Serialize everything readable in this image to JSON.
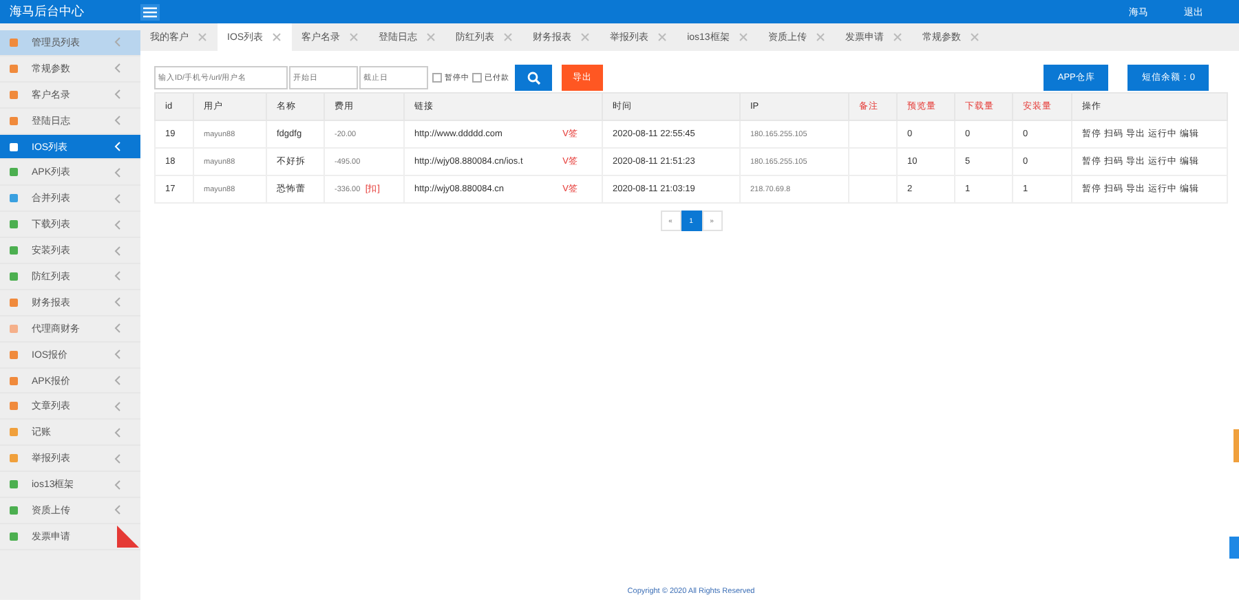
{
  "header": {
    "title": "海马后台中心",
    "user": "海马",
    "logout": "退出"
  },
  "sidebar": {
    "items": [
      {
        "label": "管理员列表",
        "color": "#f08a3c",
        "selected": false,
        "hover": true,
        "ribbon": false
      },
      {
        "label": "常规参数",
        "color": "#f08a3c",
        "selected": false,
        "hover": false,
        "ribbon": false
      },
      {
        "label": "客户名录",
        "color": "#f08a3c",
        "selected": false,
        "hover": false,
        "ribbon": false
      },
      {
        "label": "登陆日志",
        "color": "#f08a3c",
        "selected": false,
        "hover": false,
        "ribbon": false
      },
      {
        "label": "IOS列表",
        "color": "#ffffff",
        "selected": true,
        "hover": false,
        "ribbon": false
      },
      {
        "label": "APK列表",
        "color": "#4caf50",
        "selected": false,
        "hover": false,
        "ribbon": false
      },
      {
        "label": "合并列表",
        "color": "#3aa0e0",
        "selected": false,
        "hover": false,
        "ribbon": false
      },
      {
        "label": "下载列表",
        "color": "#4caf50",
        "selected": false,
        "hover": false,
        "ribbon": false
      },
      {
        "label": "安装列表",
        "color": "#4caf50",
        "selected": false,
        "hover": false,
        "ribbon": false
      },
      {
        "label": "防红列表",
        "color": "#4caf50",
        "selected": false,
        "hover": false,
        "ribbon": false
      },
      {
        "label": "财务报表",
        "color": "#f08a3c",
        "selected": false,
        "hover": false,
        "ribbon": false
      },
      {
        "label": "代理商财务",
        "color": "#f5b08a",
        "selected": false,
        "hover": false,
        "ribbon": false
      },
      {
        "label": "IOS报价",
        "color": "#f08a3c",
        "selected": false,
        "hover": false,
        "ribbon": false
      },
      {
        "label": "APK报价",
        "color": "#f08a3c",
        "selected": false,
        "hover": false,
        "ribbon": false
      },
      {
        "label": "文章列表",
        "color": "#f08a3c",
        "selected": false,
        "hover": false,
        "ribbon": false
      },
      {
        "label": "记账",
        "color": "#f0a03c",
        "selected": false,
        "hover": false,
        "ribbon": false
      },
      {
        "label": "举报列表",
        "color": "#f0a03c",
        "selected": false,
        "hover": false,
        "ribbon": false
      },
      {
        "label": "ios13框架",
        "color": "#4caf50",
        "selected": false,
        "hover": false,
        "ribbon": false
      },
      {
        "label": "资质上传",
        "color": "#4caf50",
        "selected": false,
        "hover": false,
        "ribbon": false
      },
      {
        "label": "发票申请",
        "color": "#4caf50",
        "selected": false,
        "hover": false,
        "ribbon": true
      }
    ]
  },
  "tabs": [
    {
      "label": "我的客户",
      "selected": false
    },
    {
      "label": "IOS列表",
      "selected": true
    },
    {
      "label": "客户名录",
      "selected": false
    },
    {
      "label": "登陆日志",
      "selected": false
    },
    {
      "label": "防红列表",
      "selected": false
    },
    {
      "label": "财务报表",
      "selected": false
    },
    {
      "label": "举报列表",
      "selected": false
    },
    {
      "label": "ios13框架",
      "selected": false
    },
    {
      "label": "资质上传",
      "selected": false
    },
    {
      "label": "发票申请",
      "selected": false
    },
    {
      "label": "常规参数",
      "selected": false
    }
  ],
  "toolbar": {
    "search": {
      "placeholder": "输入ID/手机号/url/用户名"
    },
    "start_date": {
      "placeholder": "开始日"
    },
    "end_date": {
      "placeholder": "截止日"
    },
    "checkboxes": [
      {
        "label": "暂停中",
        "checked": false
      },
      {
        "label": "已付款",
        "checked": false
      }
    ],
    "export": "导出",
    "app_repo": "APP仓库",
    "sms_balance": "短信余额：0"
  },
  "table": {
    "columns": [
      {
        "label": "id",
        "emphasis": false
      },
      {
        "label": "用户",
        "emphasis": false
      },
      {
        "label": "名称",
        "emphasis": false
      },
      {
        "label": "费用",
        "emphasis": false
      },
      {
        "label": "链接",
        "emphasis": false
      },
      {
        "label": "时间",
        "emphasis": false
      },
      {
        "label": "IP",
        "emphasis": false
      },
      {
        "label": "备注",
        "emphasis": true
      },
      {
        "label": "预览量",
        "emphasis": true
      },
      {
        "label": "下载量",
        "emphasis": true
      },
      {
        "label": "安装量",
        "emphasis": true
      },
      {
        "label": "操作",
        "emphasis": false
      }
    ],
    "rows": [
      {
        "id": "19",
        "user": "mayun88",
        "name": "fdgdfg",
        "fee": "-20.00",
        "fee_tag": null,
        "link": "http://www.ddddd.com",
        "link_tag": "V签",
        "time": "2020-08-11 22:55:45",
        "ip": "180.165.255.105",
        "note": null,
        "views": "0",
        "downloads": "0",
        "installs": "0",
        "actions": [
          "暂停",
          "扫码",
          "导出",
          "运行中",
          "编辑"
        ]
      },
      {
        "id": "18",
        "user": "mayun88",
        "name": "不好拆",
        "fee": "-495.00",
        "fee_tag": null,
        "link": "http://wjy08.880084.cn/ios.t",
        "link_tag": "V签",
        "time": "2020-08-11 21:51:23",
        "ip": "180.165.255.105",
        "note": null,
        "views": "10",
        "downloads": "5",
        "installs": "0",
        "actions": [
          "暂停",
          "扫码",
          "导出",
          "运行中",
          "编辑"
        ]
      },
      {
        "id": "17",
        "user": "mayun88",
        "name": "恐怖蕾",
        "fee": "-336.00",
        "fee_tag": "[扣]",
        "link": "http://wjy08.880084.cn",
        "link_tag": "V签",
        "time": "2020-08-11 21:03:19",
        "ip": "218.70.69.8",
        "note": null,
        "views": "2",
        "downloads": "1",
        "installs": "1",
        "actions": [
          "暂停",
          "扫码",
          "导出",
          "运行中",
          "编辑"
        ]
      }
    ]
  },
  "pagination": [
    {
      "label": "«",
      "selected": false
    },
    {
      "label": "1",
      "selected": true
    },
    {
      "label": "»",
      "selected": false
    }
  ],
  "footer": "Copyright © 2020 All Rights Reserved"
}
